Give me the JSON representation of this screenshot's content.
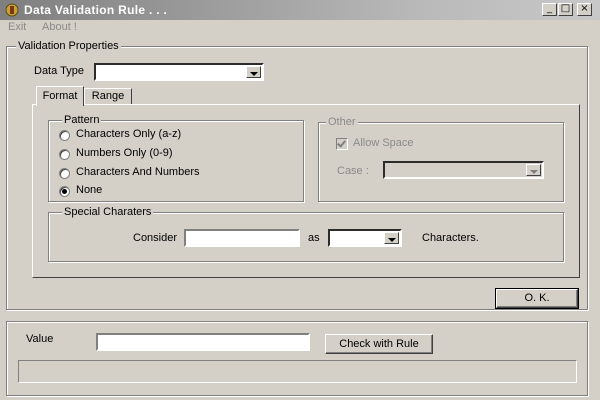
{
  "window": {
    "title": "Data Validation Rule . . ."
  },
  "menu": {
    "items": [
      "Exit",
      "About !"
    ]
  },
  "validation_properties": {
    "label": "Validation Properties",
    "data_type_label": "Data Type",
    "data_type_value": "",
    "tabs": [
      "Format",
      "Range"
    ],
    "active_tab": "Format",
    "pattern": {
      "label": "Pattern",
      "options": [
        "Characters Only (a-z)",
        "Numbers Only (0-9)",
        "Characters And Numbers",
        "None"
      ],
      "selected": "None"
    },
    "other": {
      "label": "Other",
      "allow_space_label": "Allow Space",
      "allow_space_checked": true,
      "case_label": "Case  :",
      "case_value": ""
    },
    "special": {
      "label": "Special Charaters",
      "consider_label": "Consider",
      "consider_value": "",
      "as_label": "as",
      "as_value": "",
      "characters_label": "Characters."
    },
    "ok_label": "O. K."
  },
  "test": {
    "value_label": "Value",
    "value": "",
    "check_label": "Check with Rule",
    "status_text": ""
  }
}
